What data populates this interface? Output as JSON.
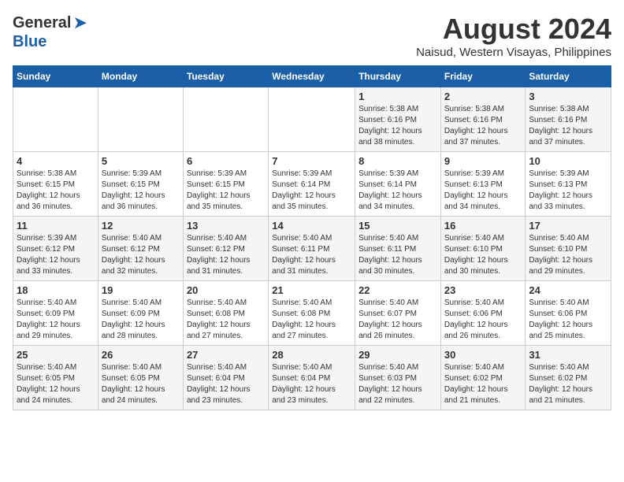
{
  "header": {
    "logo_general": "General",
    "logo_blue": "Blue",
    "title": "August 2024",
    "subtitle": "Naisud, Western Visayas, Philippines"
  },
  "weekdays": [
    "Sunday",
    "Monday",
    "Tuesday",
    "Wednesday",
    "Thursday",
    "Friday",
    "Saturday"
  ],
  "weeks": [
    [
      {
        "day": "",
        "detail": ""
      },
      {
        "day": "",
        "detail": ""
      },
      {
        "day": "",
        "detail": ""
      },
      {
        "day": "",
        "detail": ""
      },
      {
        "day": "1",
        "detail": "Sunrise: 5:38 AM\nSunset: 6:16 PM\nDaylight: 12 hours\nand 38 minutes."
      },
      {
        "day": "2",
        "detail": "Sunrise: 5:38 AM\nSunset: 6:16 PM\nDaylight: 12 hours\nand 37 minutes."
      },
      {
        "day": "3",
        "detail": "Sunrise: 5:38 AM\nSunset: 6:16 PM\nDaylight: 12 hours\nand 37 minutes."
      }
    ],
    [
      {
        "day": "4",
        "detail": "Sunrise: 5:38 AM\nSunset: 6:15 PM\nDaylight: 12 hours\nand 36 minutes."
      },
      {
        "day": "5",
        "detail": "Sunrise: 5:39 AM\nSunset: 6:15 PM\nDaylight: 12 hours\nand 36 minutes."
      },
      {
        "day": "6",
        "detail": "Sunrise: 5:39 AM\nSunset: 6:15 PM\nDaylight: 12 hours\nand 35 minutes."
      },
      {
        "day": "7",
        "detail": "Sunrise: 5:39 AM\nSunset: 6:14 PM\nDaylight: 12 hours\nand 35 minutes."
      },
      {
        "day": "8",
        "detail": "Sunrise: 5:39 AM\nSunset: 6:14 PM\nDaylight: 12 hours\nand 34 minutes."
      },
      {
        "day": "9",
        "detail": "Sunrise: 5:39 AM\nSunset: 6:13 PM\nDaylight: 12 hours\nand 34 minutes."
      },
      {
        "day": "10",
        "detail": "Sunrise: 5:39 AM\nSunset: 6:13 PM\nDaylight: 12 hours\nand 33 minutes."
      }
    ],
    [
      {
        "day": "11",
        "detail": "Sunrise: 5:39 AM\nSunset: 6:12 PM\nDaylight: 12 hours\nand 33 minutes."
      },
      {
        "day": "12",
        "detail": "Sunrise: 5:40 AM\nSunset: 6:12 PM\nDaylight: 12 hours\nand 32 minutes."
      },
      {
        "day": "13",
        "detail": "Sunrise: 5:40 AM\nSunset: 6:12 PM\nDaylight: 12 hours\nand 31 minutes."
      },
      {
        "day": "14",
        "detail": "Sunrise: 5:40 AM\nSunset: 6:11 PM\nDaylight: 12 hours\nand 31 minutes."
      },
      {
        "day": "15",
        "detail": "Sunrise: 5:40 AM\nSunset: 6:11 PM\nDaylight: 12 hours\nand 30 minutes."
      },
      {
        "day": "16",
        "detail": "Sunrise: 5:40 AM\nSunset: 6:10 PM\nDaylight: 12 hours\nand 30 minutes."
      },
      {
        "day": "17",
        "detail": "Sunrise: 5:40 AM\nSunset: 6:10 PM\nDaylight: 12 hours\nand 29 minutes."
      }
    ],
    [
      {
        "day": "18",
        "detail": "Sunrise: 5:40 AM\nSunset: 6:09 PM\nDaylight: 12 hours\nand 29 minutes."
      },
      {
        "day": "19",
        "detail": "Sunrise: 5:40 AM\nSunset: 6:09 PM\nDaylight: 12 hours\nand 28 minutes."
      },
      {
        "day": "20",
        "detail": "Sunrise: 5:40 AM\nSunset: 6:08 PM\nDaylight: 12 hours\nand 27 minutes."
      },
      {
        "day": "21",
        "detail": "Sunrise: 5:40 AM\nSunset: 6:08 PM\nDaylight: 12 hours\nand 27 minutes."
      },
      {
        "day": "22",
        "detail": "Sunrise: 5:40 AM\nSunset: 6:07 PM\nDaylight: 12 hours\nand 26 minutes."
      },
      {
        "day": "23",
        "detail": "Sunrise: 5:40 AM\nSunset: 6:06 PM\nDaylight: 12 hours\nand 26 minutes."
      },
      {
        "day": "24",
        "detail": "Sunrise: 5:40 AM\nSunset: 6:06 PM\nDaylight: 12 hours\nand 25 minutes."
      }
    ],
    [
      {
        "day": "25",
        "detail": "Sunrise: 5:40 AM\nSunset: 6:05 PM\nDaylight: 12 hours\nand 24 minutes."
      },
      {
        "day": "26",
        "detail": "Sunrise: 5:40 AM\nSunset: 6:05 PM\nDaylight: 12 hours\nand 24 minutes."
      },
      {
        "day": "27",
        "detail": "Sunrise: 5:40 AM\nSunset: 6:04 PM\nDaylight: 12 hours\nand 23 minutes."
      },
      {
        "day": "28",
        "detail": "Sunrise: 5:40 AM\nSunset: 6:04 PM\nDaylight: 12 hours\nand 23 minutes."
      },
      {
        "day": "29",
        "detail": "Sunrise: 5:40 AM\nSunset: 6:03 PM\nDaylight: 12 hours\nand 22 minutes."
      },
      {
        "day": "30",
        "detail": "Sunrise: 5:40 AM\nSunset: 6:02 PM\nDaylight: 12 hours\nand 21 minutes."
      },
      {
        "day": "31",
        "detail": "Sunrise: 5:40 AM\nSunset: 6:02 PM\nDaylight: 12 hours\nand 21 minutes."
      }
    ]
  ]
}
